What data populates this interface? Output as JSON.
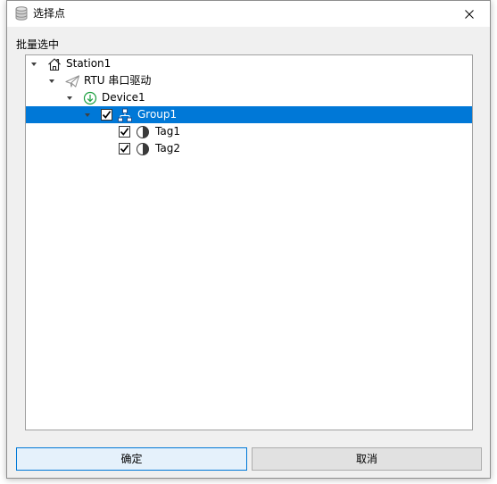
{
  "window": {
    "title": "选择点",
    "title_icon": "database-icon",
    "close_icon": "close-icon"
  },
  "batch_label": "批量选中",
  "tree": {
    "station": {
      "label": "Station1",
      "icon": "house-icon",
      "expanded": true,
      "driver": {
        "label": "RTU 串口驱动",
        "icon": "paper-plane-icon",
        "expanded": true,
        "device": {
          "label": "Device1",
          "icon": "device-download-icon",
          "expanded": true,
          "group": {
            "label": "Group1",
            "icon": "group-hierarchy-icon",
            "expanded": true,
            "checked": true,
            "selected": true,
            "tags": [
              {
                "label": "Tag1",
                "icon": "tag-half-circle-icon",
                "checked": true
              },
              {
                "label": "Tag2",
                "icon": "tag-half-circle-icon",
                "checked": true
              }
            ]
          }
        }
      }
    }
  },
  "buttons": {
    "ok_label": "确定",
    "cancel_label": "取消"
  },
  "colors": {
    "selection": "#0078d7",
    "selection-text": "#ffffff",
    "dialog-bg": "#f0f0f0",
    "device-icon": "#1a9e3d",
    "ok-button-bg": "#e5f1fb",
    "ok-button-border": "#0078d7",
    "button-bg": "#e1e1e1",
    "button-border": "#adadad"
  }
}
